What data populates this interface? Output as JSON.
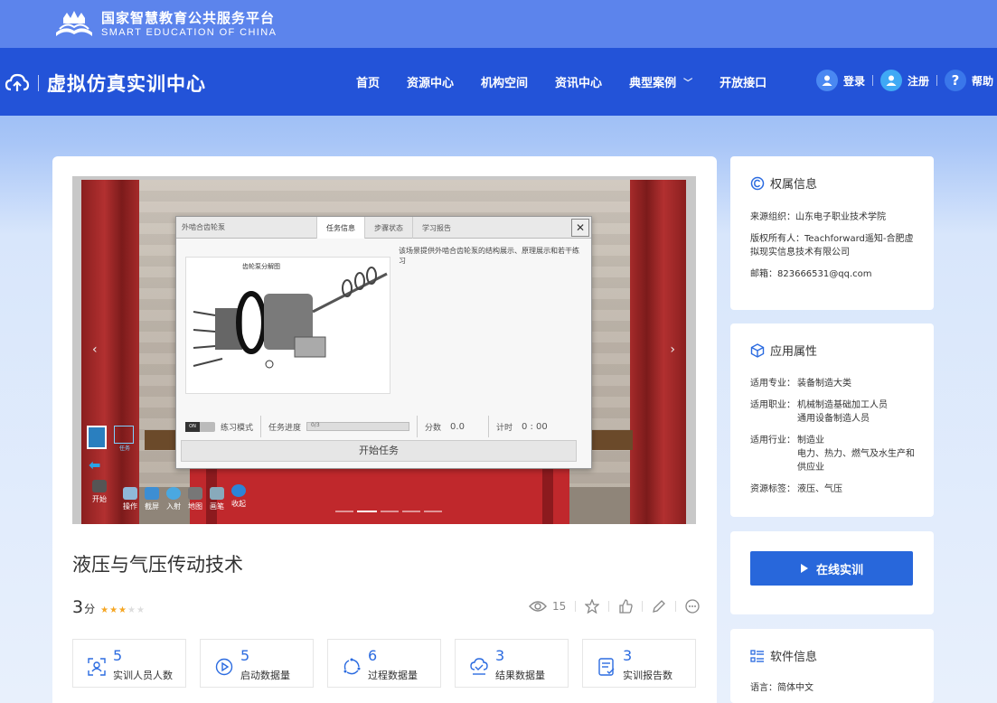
{
  "brand": {
    "name_cn": "国家智慧教育公共服务平台",
    "name_en": "SMART EDUCATION OF CHINA"
  },
  "site": {
    "title": "虚拟仿真实训中心"
  },
  "nav": [
    {
      "label": "首页"
    },
    {
      "label": "资源中心"
    },
    {
      "label": "机构空间"
    },
    {
      "label": "资讯中心"
    },
    {
      "label": "典型案例"
    },
    {
      "label": "开放接口"
    }
  ],
  "user": {
    "login": "登录",
    "register": "注册",
    "help": "帮助"
  },
  "simulation": {
    "dialog_title": "外啮合齿轮泵",
    "tabs": [
      "任务信息",
      "步骤状态",
      "学习报告"
    ],
    "close": "✕",
    "description": "该场景提供外啮合齿轮泵的结构展示、原理展示和若干练习",
    "figure_title": "齿轮泵分解图",
    "toggle_on": "ON",
    "mode_label": "练习模式",
    "progress_label": "任务进度",
    "progress_value": "0/3",
    "progress_fraction": 0.0,
    "score_label": "分数",
    "score_value": "0.0",
    "timer_label": "计时",
    "timer_value": "0 : 00",
    "start_task": "开始任务",
    "toolbar": [
      "开始",
      "操作",
      "截屏",
      "入射",
      "地图",
      "画笔",
      "收起"
    ],
    "side_tool_label": "任务"
  },
  "course": {
    "title": "液压与气压传动技术",
    "rating": "3",
    "rating_unit": "分",
    "stars_filled": 3,
    "stars_total": 5,
    "views": "15"
  },
  "stats": [
    {
      "value": "5",
      "label": "实训人员人数",
      "icon": "user-scan-icon"
    },
    {
      "value": "5",
      "label": "启动数据量",
      "icon": "play-circle-icon"
    },
    {
      "value": "6",
      "label": "过程数据量",
      "icon": "cycle-icon"
    },
    {
      "value": "3",
      "label": "结果数据量",
      "icon": "check-cloud-icon"
    },
    {
      "value": "3",
      "label": "实训报告数",
      "icon": "report-icon"
    }
  ],
  "ownership": {
    "title": "权属信息",
    "org": "来源组织：山东电子职业技术学院",
    "owner": "版权所有人：Teachforward遥知-合肥虚拟现实信息技术有限公司",
    "email": "邮箱：823666531@qq.com"
  },
  "attributes": {
    "title": "应用属性",
    "items": [
      {
        "k": "适用专业：",
        "v": "装备制造大类"
      },
      {
        "k": "适用职业：",
        "v": "机械制造基础加工人员"
      },
      {
        "k": "",
        "v": "通用设备制造人员"
      },
      {
        "k": "适用行业：",
        "v": "制造业"
      },
      {
        "k": "",
        "v": "电力、热力、燃气及水生产和供应业"
      },
      {
        "k": "资源标签：",
        "v": "液压、气压"
      }
    ]
  },
  "online": {
    "label": "在线实训"
  },
  "software": {
    "title": "软件信息",
    "language": "语言：简体中文"
  },
  "colors": {
    "topbar": "#5c84ec",
    "navbar": "#2353d8",
    "accent": "#2867db",
    "star": "#f5a623"
  }
}
